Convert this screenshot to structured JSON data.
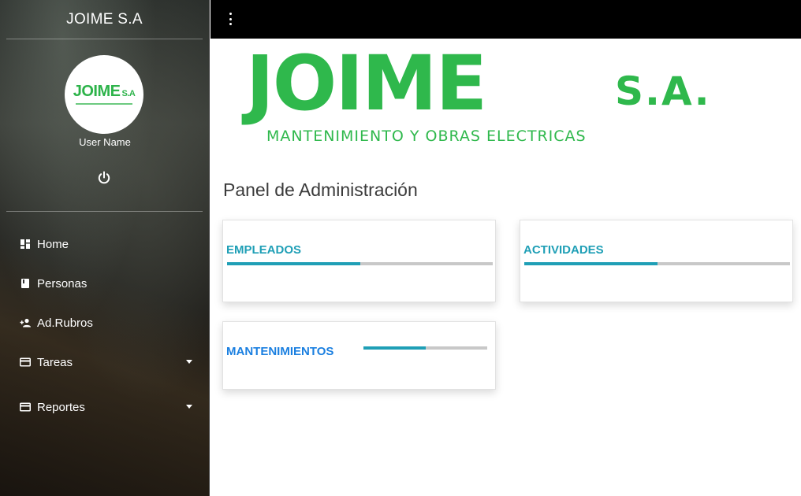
{
  "sidebar": {
    "brand": "JOIME S.A",
    "avatar_logo": {
      "main": "JOIME",
      "suffix": "S.A"
    },
    "user_name": "User Name",
    "items": [
      {
        "label": "Home",
        "icon": "dashboard-icon",
        "has_caret": false
      },
      {
        "label": "Personas",
        "icon": "book-icon",
        "has_caret": false
      },
      {
        "label": "Ad.Rubros",
        "icon": "add-user-icon",
        "has_caret": false
      },
      {
        "label": "Tareas",
        "icon": "credit-card-icon",
        "has_caret": true
      },
      {
        "label": "Reportes",
        "icon": "credit-card-icon",
        "has_caret": true
      }
    ]
  },
  "topbar": {
    "menu_icon": "kebab-menu-icon"
  },
  "banner": {
    "main": "JOIME",
    "suffix": "S.A.",
    "subtitle": "MANTENIMIENTO Y OBRAS ELECTRICAS",
    "color": "#2fb84c"
  },
  "main": {
    "title": "Panel de Administración",
    "cards": [
      {
        "title": "EMPLEADOS",
        "progress": 0.5,
        "title_color": "#1f9fb6"
      },
      {
        "title": "ACTIVIDADES",
        "progress": 0.5,
        "title_color": "#1f9fb6"
      },
      {
        "title": "MANTENIMIENTOS",
        "progress": 0.5,
        "title_color": "#1a7fe0"
      }
    ]
  },
  "colors": {
    "accent": "#1f9fb6",
    "bar_track": "#c8c8c8",
    "topbar": "#000000"
  }
}
